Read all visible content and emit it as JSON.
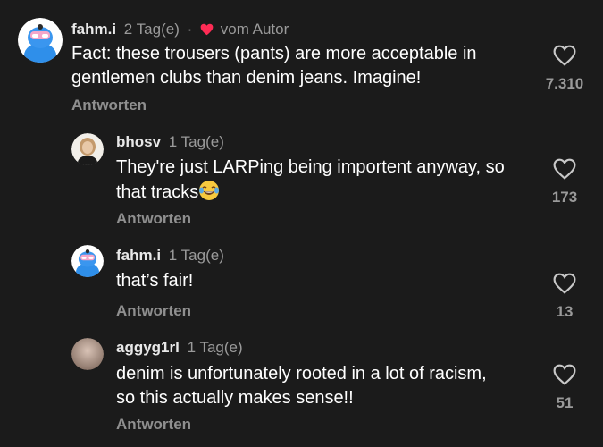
{
  "comments": [
    {
      "user": "fahm.i",
      "time": "2 Tag(e)",
      "separator": "·",
      "author_badge": "vom Autor",
      "text": "Fact: these trousers (pants) are more acceptable in gentlemen clubs than denim jeans. Imagine!",
      "reply_label": "Antworten",
      "likes": "7.310",
      "avatar_icon": "cartoon-avatar-icon"
    },
    {
      "user": "bhosv",
      "time": "1 Tag(e)",
      "text": "They're just LARPing being importent anyway, so that tracks",
      "emoji_icon": "tears-of-joy-emoji-icon",
      "reply_label": "Antworten",
      "likes": "173",
      "avatar_icon": "photo-avatar-icon"
    },
    {
      "user": "fahm.i",
      "time": "1 Tag(e)",
      "text": "that’s fair!",
      "reply_label": "Antworten",
      "likes": "13",
      "avatar_icon": "cartoon-avatar-icon"
    },
    {
      "user": "aggyg1rl",
      "time": "1 Tag(e)",
      "text": "denim is unfortunately rooted in a lot of racism, so this actually makes sense!!",
      "reply_label": "Antworten",
      "likes": "51",
      "avatar_icon": "photo-avatar-icon"
    }
  ],
  "colors": {
    "background": "#1b1b1b",
    "author_heart": "#fe2c55",
    "muted_text": "#9a9a9a"
  }
}
